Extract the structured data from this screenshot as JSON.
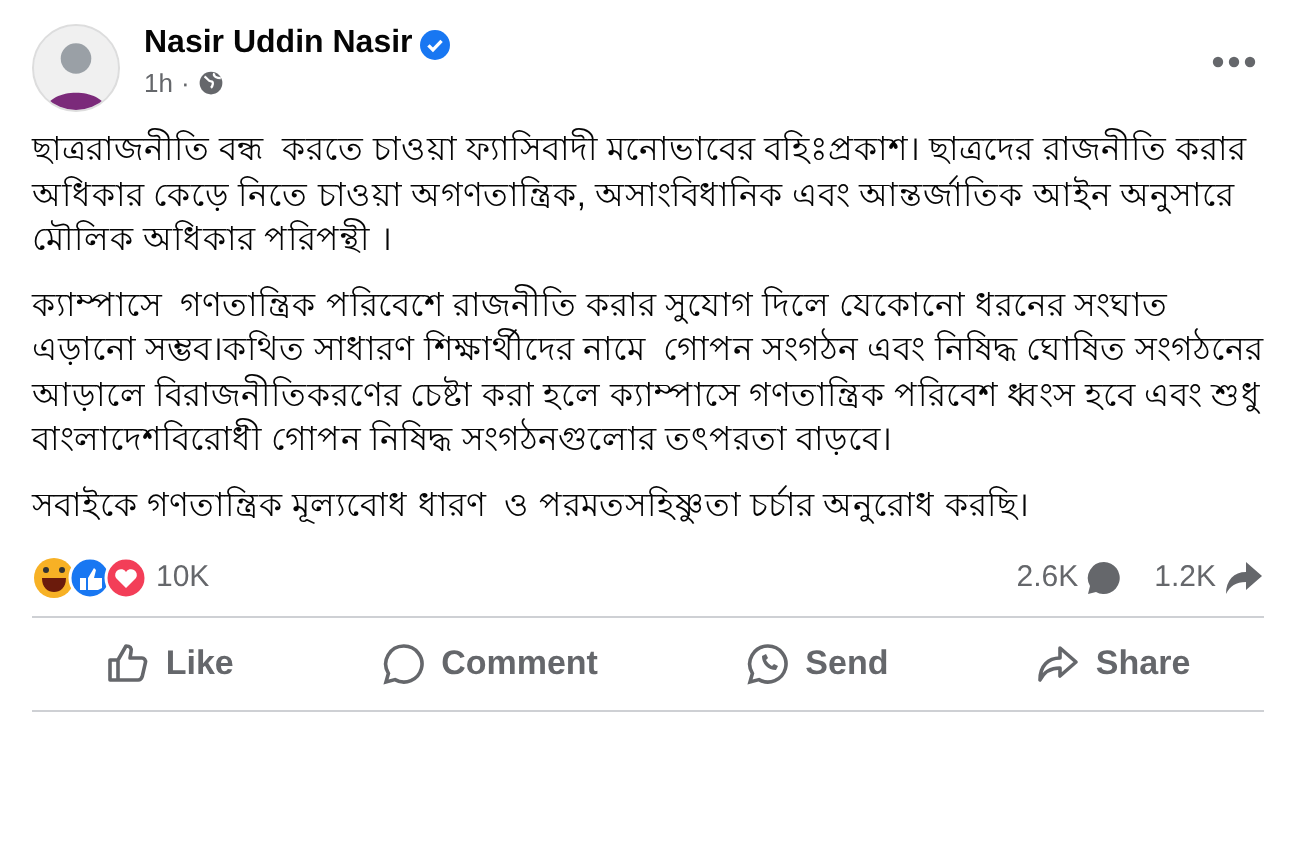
{
  "post": {
    "author": "Nasir Uddin Nasir",
    "verified": true,
    "time": "1h",
    "separator": "·",
    "paragraphs": [
      "ছাত্ররাজনীতি বন্ধ  করতে চাওয়া ফ্যাসিবাদী মনোভাবের বহিঃপ্রকাশ। ছাত্রদের রাজনীতি করার অধিকার কেড়ে নিতে চাওয়া অগণতান্ত্রিক, অসাংবিধানিক এবং আন্তর্জাতিক আইন অনুসারে মৌলিক অধিকার পরিপন্থী ।",
      "ক্যাম্পাসে  গণতান্ত্রিক পরিবেশে রাজনীতি করার সুযোগ দিলে যেকোনো ধরনের সংঘাত এড়ানো সম্ভব।কথিত সাধারণ শিক্ষার্থীদের নামে  গোপন সংগঠন এবং নিষিদ্ধ ঘোষিত সংগঠনের আড়ালে বিরাজনীতিকরণের চেষ্টা করা হলে ক্যাম্পাসে গণতান্ত্রিক পরিবেশ ধ্বংস হবে এবং শুধু বাংলাদেশবিরোধী গোপন নিষিদ্ধ সংগঠনগুলোর তৎপরতা বাড়বে।",
      "সবাইকে গণতান্ত্রিক মূল্যবোধ ধারণ  ও পরমতসহিষ্ণুতা চর্চার অনুরোধ করছি।"
    ]
  },
  "stats": {
    "reactions": "10K",
    "comments": "2.6K",
    "shares": "1.2K"
  },
  "actions": [
    {
      "kind": "like",
      "label": "Like"
    },
    {
      "kind": "comment",
      "label": "Comment"
    },
    {
      "kind": "send",
      "label": "Send"
    },
    {
      "kind": "share",
      "label": "Share"
    }
  ]
}
